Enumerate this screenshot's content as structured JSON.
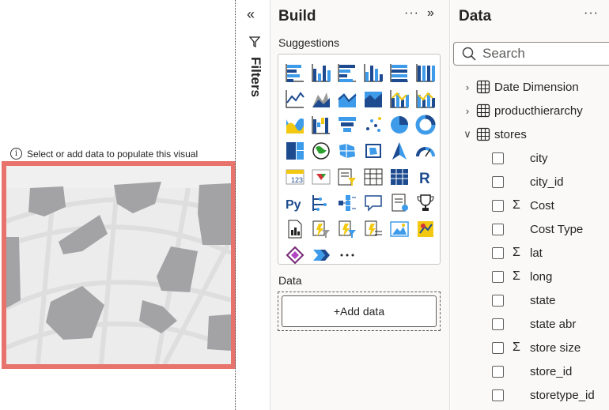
{
  "canvas": {
    "hint_text": "Select or add data to populate this visual",
    "hint_icon": "info-icon",
    "visual_border_color": "#e8736c"
  },
  "filters": {
    "collapse_icon": "double-chevron-left-icon",
    "funnel_icon": "funnel-icon",
    "label": "Filters"
  },
  "build": {
    "title": "Build",
    "more": "···",
    "expand": "»",
    "suggestions_label": "Suggestions",
    "visuals": [
      "stacked-bar-chart",
      "stacked-column-chart",
      "clustered-bar-chart",
      "clustered-column-chart",
      "100-stacked-bar-chart",
      "100-stacked-column-chart",
      "line-chart",
      "area-chart",
      "stacked-area-chart",
      "100-stacked-area-chart",
      "line-and-stacked-column-chart",
      "line-and-clustered-column-chart",
      "ribbon-chart",
      "waterfall-chart",
      "funnel-chart",
      "scatter-chart",
      "pie-chart",
      "donut-chart",
      "treemap",
      "map",
      "filled-map",
      "shape-map",
      "azure-map",
      "gauge",
      "card",
      "kpi",
      "slicer",
      "table",
      "matrix",
      "r-visual",
      "python-visual",
      "key-influencers",
      "decomposition-tree",
      "q-and-a",
      "smart-narrative",
      "metrics",
      "paginated-report",
      "power-apps",
      "power-automate",
      "power-automate-2",
      "arcgis-map",
      "azure-maps-2",
      "power-apps-2",
      "power-automate-3",
      "more-visuals"
    ],
    "data_label": "Data",
    "add_data_label": "+Add data"
  },
  "data_pane": {
    "title": "Data",
    "more": "···",
    "search_placeholder": "Search",
    "tables": [
      {
        "name": "Date Dimension",
        "expanded": false
      },
      {
        "name": "producthierarchy",
        "expanded": false
      },
      {
        "name": "stores",
        "expanded": true
      }
    ],
    "fields": [
      {
        "name": "city",
        "sigma": false
      },
      {
        "name": "city_id",
        "sigma": false
      },
      {
        "name": "Cost",
        "sigma": true
      },
      {
        "name": "Cost Type",
        "sigma": false
      },
      {
        "name": "lat",
        "sigma": true
      },
      {
        "name": "long",
        "sigma": true
      },
      {
        "name": "state",
        "sigma": false
      },
      {
        "name": "state abr",
        "sigma": false
      },
      {
        "name": "store size",
        "sigma": true
      },
      {
        "name": "store_id",
        "sigma": false
      },
      {
        "name": "storetype_id",
        "sigma": false
      }
    ]
  }
}
